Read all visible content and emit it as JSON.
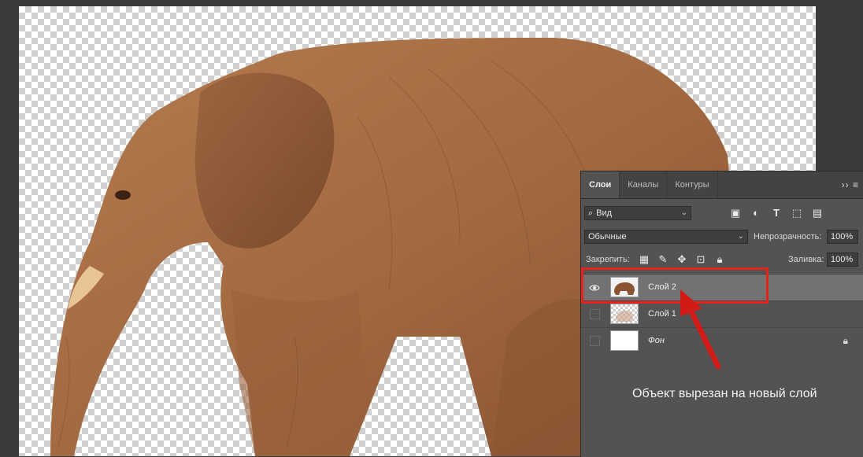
{
  "panel": {
    "tabs": [
      "Слои",
      "Каналы",
      "Контуры"
    ],
    "tabs_menu": "›› ≡",
    "filter": {
      "icon": "search-icon",
      "label": "Вид"
    },
    "filter_icons": [
      "image-icon",
      "adjustment-icon",
      "type-icon",
      "transform-icon",
      "smart-object-icon"
    ],
    "blend_mode": "Обычные",
    "opacity_label": "Непрозрачность:",
    "opacity_value": "100%",
    "lock_label": "Закрепить:",
    "lock_icons": [
      "lock-transparency-icon",
      "lock-pixels-icon",
      "lock-position-icon",
      "lock-artboard-icon",
      "lock-all-icon"
    ],
    "fill_label": "Заливка:",
    "fill_value": "100%",
    "layers": [
      {
        "name": "Слой 2",
        "visible": true,
        "selected": true
      },
      {
        "name": "Слой 1",
        "visible": false,
        "selected": false
      },
      {
        "name": "Фон",
        "visible": false,
        "selected": false,
        "locked": true
      }
    ]
  },
  "annotation": {
    "caption": "Объект вырезан на новый слой",
    "highlight_color": "#e6231b",
    "arrow_color": "#d21a17"
  }
}
